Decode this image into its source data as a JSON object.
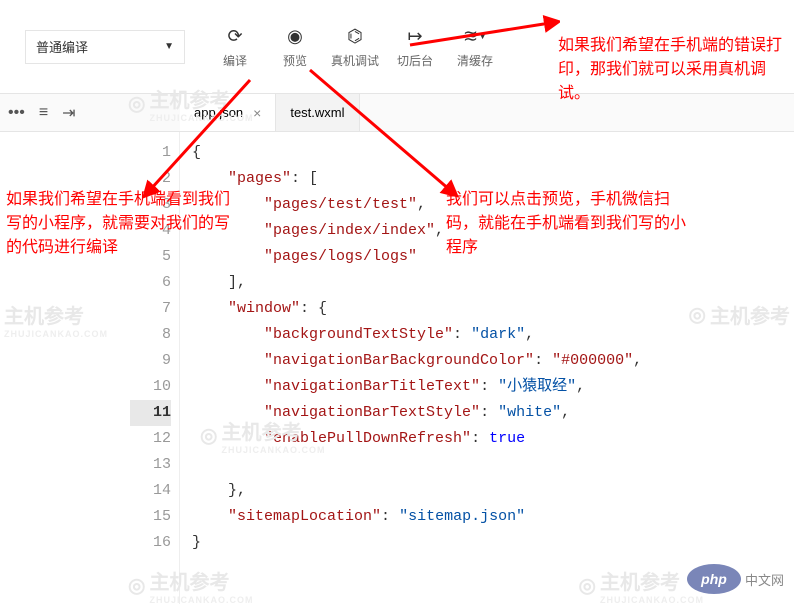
{
  "toolbar": {
    "mode": "普通编译",
    "buttons": {
      "compile": "编译",
      "preview": "预览",
      "remote_debug": "真机调试",
      "background": "切后台",
      "clear_cache": "清缓存"
    }
  },
  "tabs": {
    "active": "app.json",
    "inactive": "test.wxml"
  },
  "code": {
    "lines": [
      "1",
      "2",
      "3",
      "4",
      "5",
      "6",
      "7",
      "8",
      "9",
      "10",
      "11",
      "12",
      "13",
      "14",
      "15",
      "16"
    ],
    "pages_key": "\"pages\"",
    "page1": "\"pages/test/test\"",
    "page2": "\"pages/index/index\"",
    "page3": "\"pages/logs/logs\"",
    "window_key": "\"window\"",
    "bg_key": "\"backgroundTextStyle\"",
    "bg_val": "\"dark\"",
    "navbg_key": "\"navigationBarBackgroundColor\"",
    "navbg_val": "\"#000000\"",
    "title_key": "\"navigationBarTitleText\"",
    "title_val": "\"小猿取经\"",
    "navtxt_key": "\"navigationBarTextStyle\"",
    "navtxt_val": "\"white\"",
    "pull_key": "\"enablePullDownRefresh\"",
    "pull_val": "true",
    "sitemap_key": "\"sitemapLocation\"",
    "sitemap_val": "\"sitemap.json\""
  },
  "annotations": {
    "top_right": "如果我们希望在手机端的错误打印，那我们就可以采用真机调试。",
    "left": "如果我们希望在手机端看到我们写的小程序，就需要对我们的写的代码进行编译",
    "right": "我们可以点击预览，手机微信扫码，就能在手机端看到我们写的小程序"
  },
  "watermark": {
    "cn": "主机参考",
    "en": "ZHUJICANKAO.COM"
  },
  "php": {
    "logo": "php",
    "text": "中文网"
  }
}
